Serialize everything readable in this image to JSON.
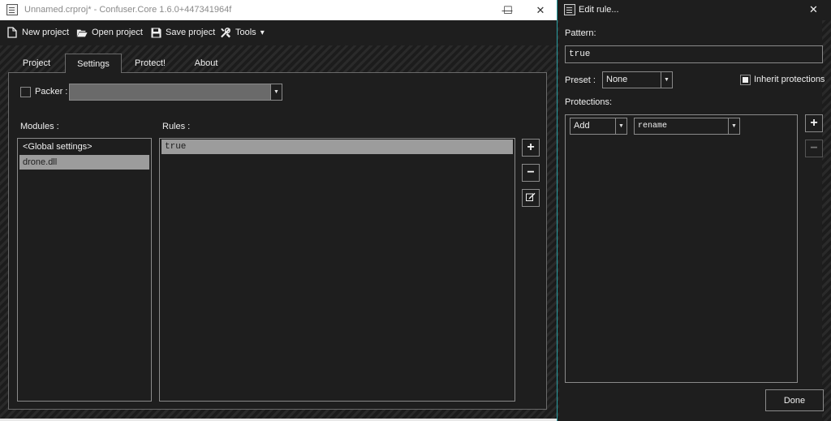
{
  "main_window": {
    "title": "Unnamed.crproj* - Confuser.Core 1.6.0+447341964f",
    "caption": {
      "minimize": "—",
      "maximize": "☐",
      "close": "✕"
    }
  },
  "toolbar": {
    "new_project": "New project",
    "open_project": "Open project",
    "save_project": "Save project",
    "tools": "Tools",
    "tools_arrow": "▾"
  },
  "tabs": [
    {
      "label": "Project",
      "active": false
    },
    {
      "label": "Settings",
      "active": true
    },
    {
      "label": "Protect!",
      "active": false
    },
    {
      "label": "About",
      "active": false
    }
  ],
  "settings": {
    "packer_label": "Packer :",
    "packer_value": "",
    "modules_label": "Modules :",
    "modules": [
      "<Global settings>",
      "drone.dll"
    ],
    "modules_selected_index": 1,
    "rules_label": "Rules :",
    "rules": [
      "true"
    ],
    "rules_selected_index": 0,
    "add_rule": "+",
    "remove_rule": "−"
  },
  "edit_rule": {
    "title": "Edit rule...",
    "close": "✕",
    "pattern_label": "Pattern:",
    "pattern_value": "true",
    "preset_label": "Preset :",
    "preset_value": "None",
    "inherit_label": "Inherit protections",
    "inherit_checked": true,
    "protections_label": "Protections:",
    "protections": [
      {
        "action": "Add",
        "name": "rename"
      }
    ],
    "add_protection": "+",
    "remove_protection": "−",
    "done": "Done"
  },
  "colors": {
    "background": "#1e1e1e",
    "border": "#8a8a8a",
    "selection": "#9c9c9c",
    "dialog_accent": "#2aa0a4"
  }
}
